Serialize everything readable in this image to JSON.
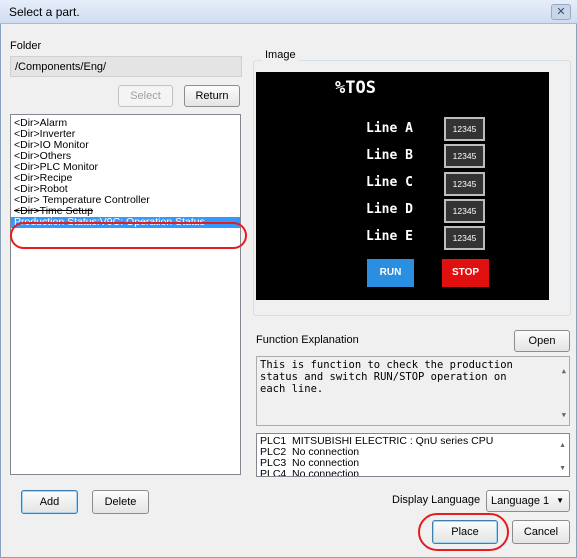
{
  "window": {
    "title": "Select a part.",
    "close_glyph": "✕"
  },
  "folder": {
    "label": "Folder",
    "path": "/Components/Eng/"
  },
  "buttons": {
    "select": "Select",
    "return": "Return",
    "add": "Add",
    "delete": "Delete",
    "open": "Open",
    "place": "Place",
    "cancel": "Cancel"
  },
  "parts_list": {
    "items": [
      "<Dir>Alarm",
      "<Dir>Inverter",
      "<Dir>IO Monitor",
      "<Dir>Others",
      "<Dir>PLC Monitor",
      "<Dir>Recipe",
      "<Dir>Robot",
      "<Dir> Temperature Controller",
      "<Dir>Time Setup",
      "Production Status:V9C:  Operation Status"
    ],
    "selected_index": 9
  },
  "image": {
    "label": "Image",
    "preview_title": "%TOS",
    "lines": [
      {
        "name": "Line A",
        "value": "12345"
      },
      {
        "name": "Line B",
        "value": "12345"
      },
      {
        "name": "Line C",
        "value": "12345"
      },
      {
        "name": "Line D",
        "value": "12345"
      },
      {
        "name": "Line E",
        "value": "12345"
      }
    ],
    "run_label": "RUN",
    "stop_label": "STOP"
  },
  "function_explanation": {
    "label": "Function Explanation",
    "lines": [
      "This is function to check the production",
      "status and switch RUN/STOP operation on",
      "each line."
    ]
  },
  "plc_list": [
    {
      "id": "PLC1",
      "value": "MITSUBISHI ELECTRIC : QnU series CPU"
    },
    {
      "id": "PLC2",
      "value": "No connection"
    },
    {
      "id": "PLC3",
      "value": "No connection"
    },
    {
      "id": "PLC4",
      "value": "No connection"
    }
  ],
  "display_language": {
    "label": "Display Language",
    "value": "Language 1"
  },
  "colors": {
    "highlight_oval": "#e41e1e",
    "selection": "#3399ff",
    "run": "#2a8fe0",
    "stop": "#e01010"
  }
}
